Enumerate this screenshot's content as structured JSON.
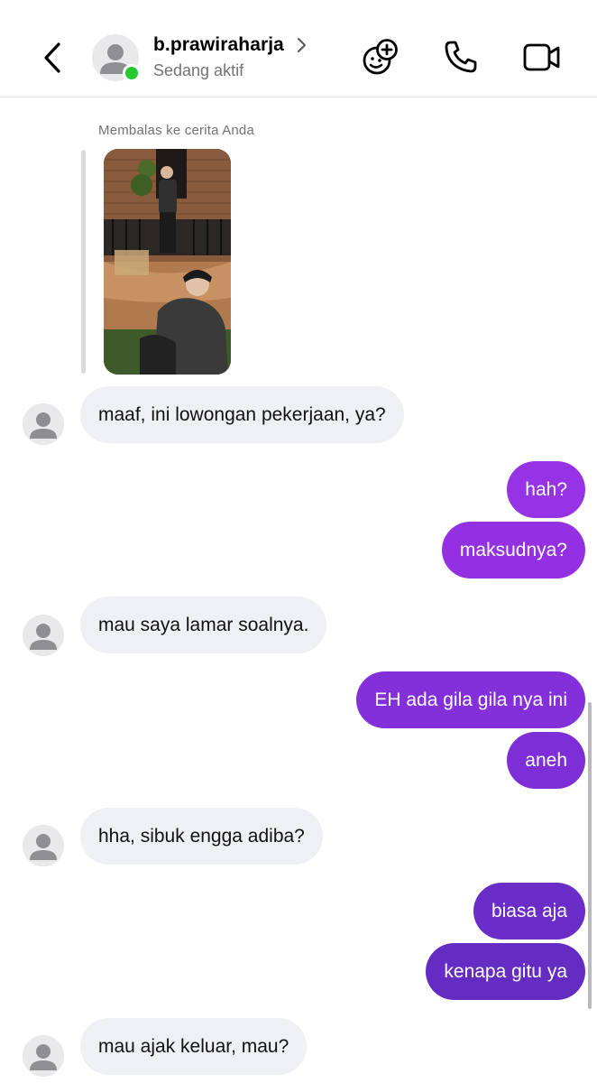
{
  "header": {
    "username": "b.prawiraharja",
    "status": "Sedang aktif"
  },
  "story_reply": {
    "label": "Membalas ke cerita Anda"
  },
  "messages": [
    {
      "side": "in",
      "text": "maaf, ini lowongan pekerjaan, ya?"
    },
    {
      "side": "out",
      "text": "hah?"
    },
    {
      "side": "out",
      "text": "maksudnya?"
    },
    {
      "side": "in",
      "text": "mau saya lamar soalnya."
    },
    {
      "side": "out",
      "text": "EH ada gila gila nya ini"
    },
    {
      "side": "out",
      "text": "aneh"
    },
    {
      "side": "in",
      "text": "hha, sibuk engga adiba?"
    },
    {
      "side": "out",
      "text": "biasa aja"
    },
    {
      "side": "out",
      "text": "kenapa gitu ya"
    },
    {
      "side": "in",
      "text": "mau ajak keluar, mau?"
    }
  ],
  "colors": {
    "outgoing_top": "#a034ea",
    "outgoing_bottom": "#5b2bb5",
    "incoming_bg": "#eff0f3",
    "online": "#22c931"
  },
  "icons": [
    "back-arrow-icon",
    "chevron-right-icon",
    "add-effect-icon",
    "phone-icon",
    "video-call-icon",
    "default-avatar-icon"
  ]
}
